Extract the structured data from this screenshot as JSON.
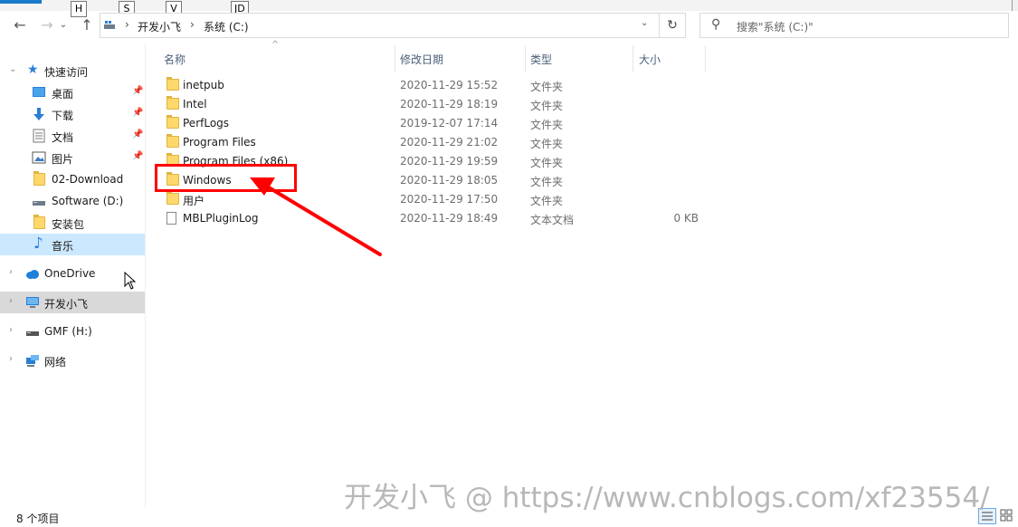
{
  "keytips": [
    "H",
    "S",
    "V",
    "JD"
  ],
  "address": {
    "crumbs": [
      "开发小飞",
      "系统 (C:)"
    ],
    "separator": "›"
  },
  "search": {
    "placeholder": "搜索\"系统 (C:)\""
  },
  "nav_pane": {
    "quick_access": "快速访问",
    "items": [
      {
        "label": "桌面",
        "icon": "desktop-icon",
        "pinned": true
      },
      {
        "label": "下载",
        "icon": "download-icon",
        "pinned": true
      },
      {
        "label": "文档",
        "icon": "document-icon",
        "pinned": true
      },
      {
        "label": "图片",
        "icon": "picture-icon",
        "pinned": true
      },
      {
        "label": "02-Download",
        "icon": "folder-icon",
        "pinned": false
      },
      {
        "label": "Software (D:)",
        "icon": "drive-icon",
        "pinned": false
      },
      {
        "label": "安装包",
        "icon": "folder-icon",
        "pinned": false
      },
      {
        "label": "音乐",
        "icon": "music-icon",
        "pinned": false
      }
    ],
    "onedrive": "OneDrive",
    "this_pc": "开发小飞",
    "usb": "GMF (H:)",
    "network": "网络"
  },
  "columns": {
    "name": "名称",
    "date": "修改日期",
    "type": "类型",
    "size": "大小"
  },
  "files": [
    {
      "name": "inetpub",
      "date": "2020-11-29 15:52",
      "type": "文件夹",
      "size": "",
      "icon": "folder-icon"
    },
    {
      "name": "Intel",
      "date": "2020-11-29 18:19",
      "type": "文件夹",
      "size": "",
      "icon": "folder-icon"
    },
    {
      "name": "PerfLogs",
      "date": "2019-12-07 17:14",
      "type": "文件夹",
      "size": "",
      "icon": "folder-icon"
    },
    {
      "name": "Program Files",
      "date": "2020-11-29 21:02",
      "type": "文件夹",
      "size": "",
      "icon": "folder-icon"
    },
    {
      "name": "Program Files (x86)",
      "date": "2020-11-29 19:59",
      "type": "文件夹",
      "size": "",
      "icon": "folder-icon"
    },
    {
      "name": "Windows",
      "date": "2020-11-29 18:05",
      "type": "文件夹",
      "size": "",
      "icon": "folder-icon"
    },
    {
      "name": "用户",
      "date": "2020-11-29 17:50",
      "type": "文件夹",
      "size": "",
      "icon": "folder-icon"
    },
    {
      "name": "MBLPluginLog",
      "date": "2020-11-29 18:49",
      "type": "文本文档",
      "size": "0 KB",
      "icon": "text-file-icon"
    }
  ],
  "status": {
    "item_count": "8 个项目"
  },
  "watermark": "开发小飞 @ https://www.cnblogs.com/xf23554/",
  "colors": {
    "annotation": "#ff0000",
    "selection": "#cce8ff",
    "folder": "#ffd86b"
  }
}
